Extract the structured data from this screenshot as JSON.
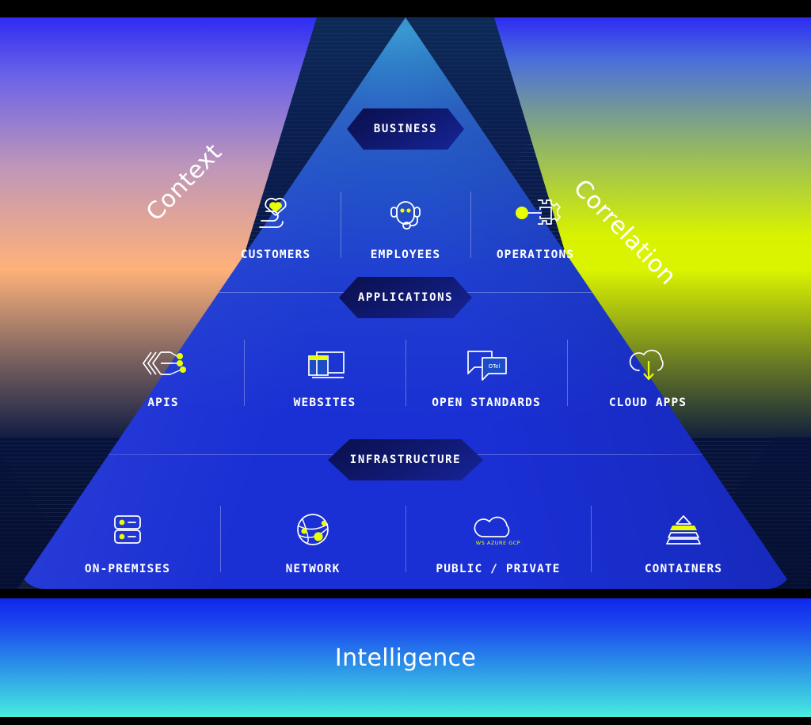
{
  "diagram": {
    "side_labels": {
      "left": "Context",
      "right": "Correlation"
    },
    "tiers": [
      {
        "badge": "BUSINESS",
        "items": [
          {
            "label": "CUSTOMERS",
            "icon": "heart-hand-icon"
          },
          {
            "label": "EMPLOYEES",
            "icon": "headset-agent-icon"
          },
          {
            "label": "OPERATIONS",
            "icon": "gear-cog-icon"
          }
        ]
      },
      {
        "badge": "APPLICATIONS",
        "items": [
          {
            "label": "APIS",
            "icon": "api-node-icon"
          },
          {
            "label": "WEBSITES",
            "icon": "browser-windows-icon"
          },
          {
            "label": "OPEN STANDARDS",
            "icon": "speech-bubbles-icon",
            "inner_text": "OTel"
          },
          {
            "label": "CLOUD APPS",
            "icon": "cloud-download-icon"
          }
        ]
      },
      {
        "badge": "INFRASTRUCTURE",
        "items": [
          {
            "label": "ON-PREMISES",
            "icon": "server-rack-icon"
          },
          {
            "label": "NETWORK",
            "icon": "globe-network-icon"
          },
          {
            "label": "PUBLIC / PRIVATE",
            "icon": "cloud-providers-icon",
            "inner_text": "WS  AZURE  GCP"
          },
          {
            "label": "CONTAINERS",
            "icon": "stacked-layers-icon"
          }
        ]
      }
    ],
    "footer_band": {
      "label": "Intelligence"
    },
    "colors": {
      "accent_yellow": "#eaff00",
      "pyramid_blue": "#2353c8",
      "deep_blue": "#1a2fd4",
      "badge_navy": "#101a73",
      "band_top": "#1026ec",
      "band_bottom": "#49efe0",
      "glow_left_warm": "#ffb179",
      "glow_right_lime": "#e8ff00"
    }
  }
}
